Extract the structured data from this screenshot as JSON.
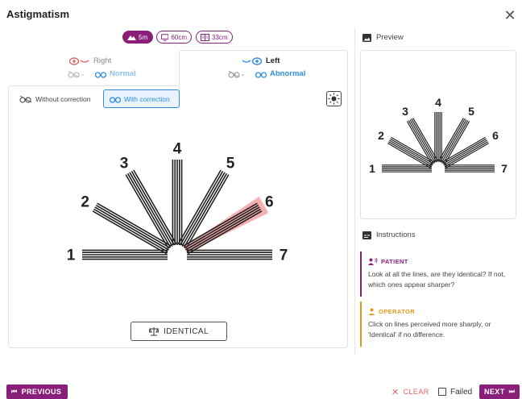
{
  "header": {
    "title": "Astigmatism"
  },
  "distances": [
    {
      "label": "5m",
      "icon": "mountain-icon",
      "active": true
    },
    {
      "label": "60cm",
      "icon": "monitor-icon",
      "active": false
    },
    {
      "label": "33cm",
      "icon": "book-icon",
      "active": false
    }
  ],
  "eyes": {
    "right": {
      "label": "Right",
      "status": "Normal"
    },
    "left": {
      "label": "Left",
      "status": "Abnormal"
    }
  },
  "correction": {
    "without": "Without correction",
    "with": "With correction",
    "selected": "with"
  },
  "chart": {
    "numbers": [
      "1",
      "2",
      "3",
      "4",
      "5",
      "6",
      "7"
    ],
    "selected_line": "6"
  },
  "identical_label": "IDENTICAL",
  "preview": {
    "title": "Preview",
    "numbers": [
      "1",
      "2",
      "3",
      "4",
      "5",
      "6",
      "7"
    ]
  },
  "instructions": {
    "title": "Instructions",
    "patient": {
      "heading": "PATIENT",
      "text": "Look at all the lines, are they identical? If not, which ones appear sharper?"
    },
    "operator": {
      "heading": "OPERATOR",
      "text": "Click on lines perceived more sharply, or 'Identical' if no difference."
    }
  },
  "footer": {
    "previous": "PREVIOUS",
    "clear": "CLEAR",
    "failed": "Failed",
    "next": "NEXT"
  },
  "colors": {
    "brand": "#8a1f7a",
    "blue": "#2d8ee0",
    "red": "#e36464",
    "amber": "#e09a1a"
  }
}
